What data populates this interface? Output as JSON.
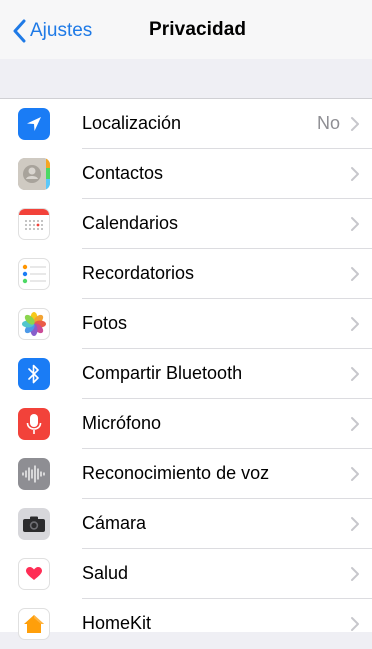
{
  "nav": {
    "back_label": "Ajustes",
    "title": "Privacidad"
  },
  "rows": [
    {
      "label": "Localización",
      "value": "No",
      "icon": "location-arrow-icon",
      "color": "#1a7cf5"
    },
    {
      "label": "Contactos",
      "icon": "contacts-icon",
      "color": "#b9b5ad"
    },
    {
      "label": "Calendarios",
      "icon": "calendar-icon",
      "color": "#ffffff"
    },
    {
      "label": "Recordatorios",
      "icon": "reminders-icon",
      "color": "#ffffff"
    },
    {
      "label": "Fotos",
      "icon": "photos-icon",
      "color": "#ffffff"
    },
    {
      "label": "Compartir Bluetooth",
      "icon": "bluetooth-icon",
      "color": "#1a7cf5"
    },
    {
      "label": "Micrófono",
      "icon": "microphone-icon",
      "color": "#f2423a"
    },
    {
      "label": "Reconocimiento de voz",
      "icon": "speech-waveform-icon",
      "color": "#8e8e93"
    },
    {
      "label": "Cámara",
      "icon": "camera-icon",
      "color": "#d7d7db"
    },
    {
      "label": "Salud",
      "icon": "health-heart-icon",
      "color": "#ffffff"
    },
    {
      "label": "HomeKit",
      "icon": "homekit-house-icon",
      "color": "#ffffff"
    }
  ]
}
